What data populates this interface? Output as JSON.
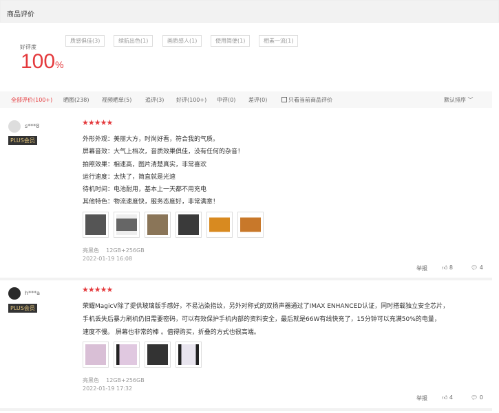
{
  "header": {
    "title": "商品评价"
  },
  "summary": {
    "rate_label": "好评度",
    "rate_value": "100",
    "rate_unit": "%",
    "tags": [
      "质感俱佳(3)",
      "续航出色(1)",
      "画质感人(1)",
      "使用简便(1)",
      "相素一流(1)"
    ]
  },
  "filters": {
    "items": [
      "全部评价(100+)",
      "晒图(238)",
      "视频晒单(5)",
      "追评(3)",
      "好评(100+)",
      "中评(0)",
      "差评(0)"
    ],
    "checkbox_label": "只看当前商品评价",
    "sort_label": "默认排序"
  },
  "reviews": [
    {
      "user": "s***8",
      "badge": "PLUS会员",
      "stars": "★★★★★",
      "lines": [
        "外形外观：美丽大方，时尚好看，符合我的气质。",
        "屏幕音效：大气上档次，音质效果俱佳，没有任何的杂音！",
        "拍照效果：相速高，图片清楚真实，非常喜欢",
        "运行速度：太快了，简直就是光速",
        "待机时间：电池耐用，基本上一天都不用充电",
        "其他特色：物流速度快，服务态度好，非常满意！"
      ],
      "color": "亮黑色",
      "spec": "12GB+256GB",
      "date": "2022-01-19 16:08",
      "report": "举报",
      "likes": "8",
      "comments": "4"
    },
    {
      "user": "h***a",
      "badge": "PLUS会员",
      "stars": "★★★★★",
      "lines": [
        "荣耀MagicV除了提供玻璃版手感好，不易沾染指纹，另外对称式的双扬声器通过了IMAX ENHANCED认证，同时搭载独立安全芯片，",
        "手机丢失后暴力刷机仍旧需要密码，可以有效保护手机内部的资料安全，最后就是66W有线快充了，15分钟可以充满50%的电量，",
        "速度不慢。 屏幕也非常的棒 。值得购买，折叠的方式也很高端。"
      ],
      "color": "亮黑色",
      "spec": "12GB+256GB",
      "date": "2022-01-19 17:32",
      "report": "举报",
      "likes": "4",
      "comments": "0"
    }
  ]
}
